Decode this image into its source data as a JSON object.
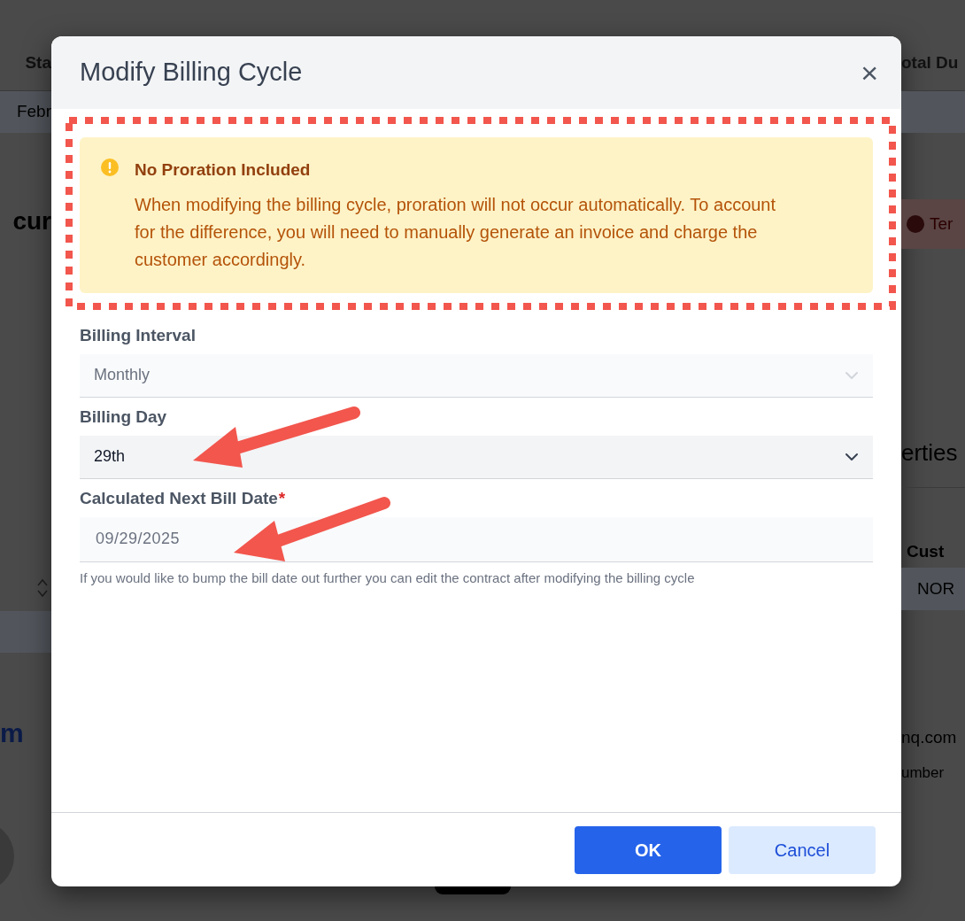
{
  "background": {
    "left": {
      "header_cell": "Sta",
      "row_cell": "Febr",
      "heading": "cur",
      "link_text": "m"
    },
    "right": {
      "header_cell": "otal Du",
      "status_badge": "Ter",
      "section_heading": "erties",
      "column_header": "Cust",
      "row_cell_2": "NOR",
      "email": "nq.com",
      "field_label": "umber"
    }
  },
  "dialog": {
    "title": "Modify Billing Cycle",
    "close": "×",
    "alert": {
      "kind": "warning",
      "title": "No Proration Included",
      "message": "When modifying the billing cycle, proration will not occur automatically. To account for the difference, you will need to manually generate an invoice and charge the customer accordingly."
    },
    "fields": [
      {
        "kind": "select",
        "label": "Billing Interval",
        "value": "Monthly",
        "disabled": true,
        "required": false
      },
      {
        "kind": "select",
        "label": "Billing Day",
        "value": "29th",
        "disabled": false,
        "required": false
      },
      {
        "kind": "text",
        "label": "Calculated Next Bill Date",
        "value": "09/29/2025",
        "disabled": true,
        "required": true,
        "required_mark": "*",
        "hint": "If you would like to bump the bill date out further you can edit the contract after modifying the billing cycle"
      }
    ],
    "buttons": [
      {
        "label": "OK",
        "kind": "primary"
      },
      {
        "label": "Cancel",
        "kind": "secondary"
      }
    ]
  }
}
